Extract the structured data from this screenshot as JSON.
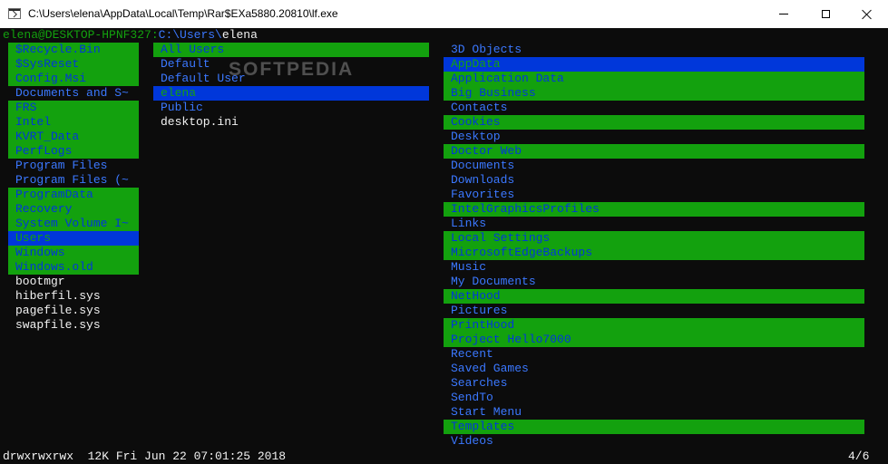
{
  "window": {
    "title": "C:\\Users\\elena\\AppData\\Local\\Temp\\Rar$EXa5880.20810\\lf.exe"
  },
  "header": {
    "user": "elena@DESKTOP-HPNF327",
    "separator": ":",
    "path": "C:\\Users\\",
    "current": "elena"
  },
  "watermark": "SOFTPEDIA",
  "parent_column": [
    {
      "name": "$Recycle.Bin",
      "style": "hl"
    },
    {
      "name": "$SysReset",
      "style": "hl"
    },
    {
      "name": "Config.Msi",
      "style": "hl"
    },
    {
      "name": "Documents and S~",
      "style": "dir"
    },
    {
      "name": "FRS",
      "style": "hl"
    },
    {
      "name": "Intel",
      "style": "hl"
    },
    {
      "name": "KVRT_Data",
      "style": "hl"
    },
    {
      "name": "PerfLogs",
      "style": "hl"
    },
    {
      "name": "Program Files",
      "style": "dir"
    },
    {
      "name": "Program Files (~",
      "style": "dir"
    },
    {
      "name": "ProgramData",
      "style": "hl"
    },
    {
      "name": "Recovery",
      "style": "hl"
    },
    {
      "name": "System Volume I~",
      "style": "hl"
    },
    {
      "name": "Users",
      "style": "sel"
    },
    {
      "name": "Windows",
      "style": "hl"
    },
    {
      "name": "Windows.old",
      "style": "hl"
    },
    {
      "name": "bootmgr",
      "style": "file"
    },
    {
      "name": "hiberfil.sys",
      "style": "file"
    },
    {
      "name": "pagefile.sys",
      "style": "file"
    },
    {
      "name": "swapfile.sys",
      "style": "file"
    }
  ],
  "current_column": [
    {
      "name": "All Users",
      "style": "hl"
    },
    {
      "name": "Default",
      "style": "dir"
    },
    {
      "name": "Default User",
      "style": "dir"
    },
    {
      "name": "elena",
      "style": "sel"
    },
    {
      "name": "Public",
      "style": "dir"
    },
    {
      "name": "desktop.ini",
      "style": "file"
    }
  ],
  "preview_column": [
    {
      "name": "3D Objects",
      "style": "dir"
    },
    {
      "name": "AppData",
      "style": "sel"
    },
    {
      "name": "Application Data",
      "style": "hl"
    },
    {
      "name": "Big Business",
      "style": "hl"
    },
    {
      "name": "Contacts",
      "style": "dir"
    },
    {
      "name": "Cookies",
      "style": "hl"
    },
    {
      "name": "Desktop",
      "style": "dir"
    },
    {
      "name": "Doctor Web",
      "style": "hl"
    },
    {
      "name": "Documents",
      "style": "dir"
    },
    {
      "name": "Downloads",
      "style": "dir"
    },
    {
      "name": "Favorites",
      "style": "dir"
    },
    {
      "name": "IntelGraphicsProfiles",
      "style": "hl"
    },
    {
      "name": "Links",
      "style": "dir"
    },
    {
      "name": "Local Settings",
      "style": "hl"
    },
    {
      "name": "MicrosoftEdgeBackups",
      "style": "hl"
    },
    {
      "name": "Music",
      "style": "dir"
    },
    {
      "name": "My Documents",
      "style": "dir"
    },
    {
      "name": "NetHood",
      "style": "hl"
    },
    {
      "name": "Pictures",
      "style": "dir"
    },
    {
      "name": "PrintHood",
      "style": "hl"
    },
    {
      "name": "Project Hello7000",
      "style": "hl"
    },
    {
      "name": "Recent",
      "style": "dir"
    },
    {
      "name": "Saved Games",
      "style": "dir"
    },
    {
      "name": "Searches",
      "style": "dir"
    },
    {
      "name": "SendTo",
      "style": "dir"
    },
    {
      "name": "Start Menu",
      "style": "dir"
    },
    {
      "name": "Templates",
      "style": "hl"
    },
    {
      "name": "Videos",
      "style": "dir"
    }
  ],
  "status": {
    "info": "drwxrwxrwx  12K Fri Jun 22 07:01:25 2018",
    "position": "4/6"
  },
  "colors": {
    "terminal_bg": "#0c0c0c",
    "green": "#13a10e",
    "blue": "#3b78ff",
    "select_blue": "#0037da",
    "white": "#f2f2f2"
  }
}
